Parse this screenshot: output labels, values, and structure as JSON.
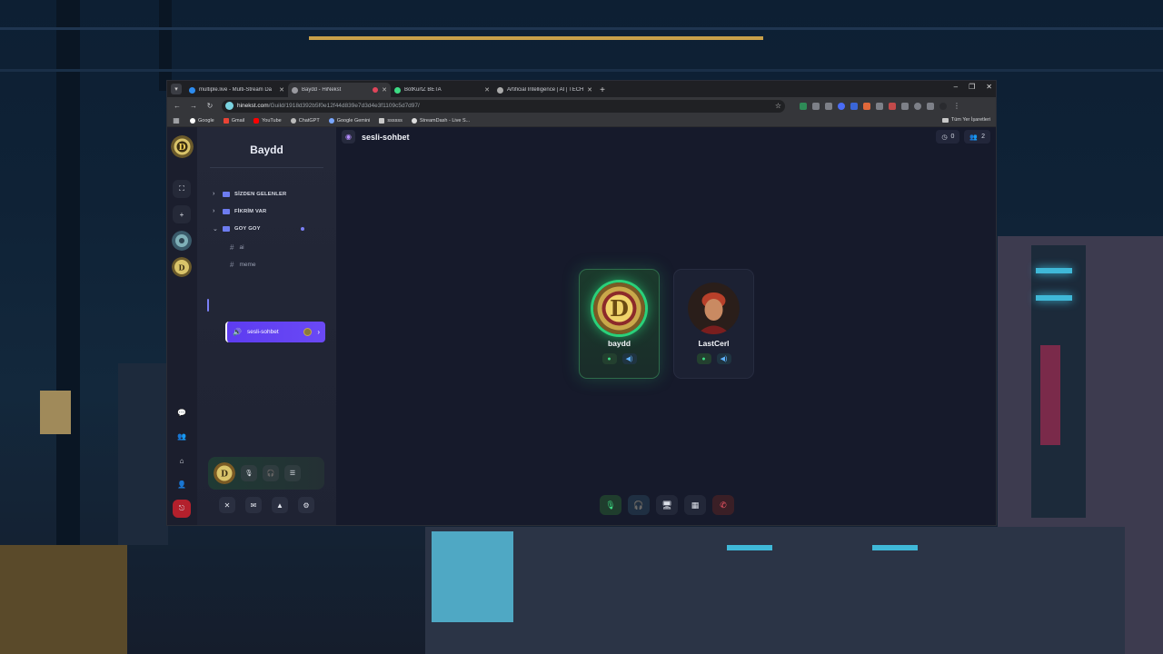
{
  "browser": {
    "tabs": [
      {
        "title": "multiple.live - Multi-Stream Da",
        "active": false
      },
      {
        "title": "Baydd - HiNekst",
        "active": true
      },
      {
        "title": "BotKurtZ BETA",
        "active": false
      },
      {
        "title": "Artificial Intelligence | AI | TECH",
        "active": false
      }
    ],
    "url_host": "hinekst.com",
    "url_path": "/Guild/1918d392b5f0e12f44d839e7d3d4e3f1109c5d7d97/",
    "bookmarks": [
      "Google",
      "Gmail",
      "YouTube",
      "ChatGPT",
      "Google Gemini",
      "ssssss",
      "StreamDash - Live S..."
    ],
    "bookmarks_right": "Tüm Yer İşaretleri"
  },
  "guild": {
    "name": "Baydd",
    "categories": [
      {
        "label": "SİZDEN GELENLER",
        "expanded": false
      },
      {
        "label": "FİKRİM VAR",
        "expanded": false
      },
      {
        "label": "GOY GOY",
        "expanded": true
      }
    ],
    "text_channels": [
      "ai",
      "meme"
    ],
    "voice_channel": "sesli-sohbet"
  },
  "header": {
    "channel": "sesli-sohbet",
    "count_a": "0",
    "count_b": "2"
  },
  "voice_users": [
    {
      "name": "baydd",
      "speaking": true
    },
    {
      "name": "LastCerl",
      "speaking": false
    }
  ],
  "colors": {
    "accent": "#6a49f5",
    "speaking": "#2ad17a",
    "danger": "#ff5a6a"
  }
}
